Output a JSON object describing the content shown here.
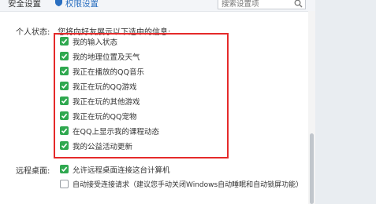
{
  "top_nav": {
    "safety_label": "安全设置",
    "permission_label": "权限设置",
    "search_placeholder": "搜索设置项"
  },
  "personal_status": {
    "label": "个人状态:",
    "hint": "您将向好友展示以下选中的信息:",
    "items": [
      {
        "label": "我的输入状态",
        "checked": true
      },
      {
        "label": "我的地理位置及天气",
        "checked": true
      },
      {
        "label": "我正在播放的QQ音乐",
        "checked": true
      },
      {
        "label": "我正在玩的QQ游戏",
        "checked": true
      },
      {
        "label": "我正在玩的其他游戏",
        "checked": true
      },
      {
        "label": "我正在玩的QQ宠物",
        "checked": true
      },
      {
        "label": "在QQ上显示我的课程动态",
        "checked": true
      },
      {
        "label": "我的公益活动更新",
        "checked": true
      }
    ]
  },
  "remote_desktop": {
    "label": "远程桌面:",
    "items": [
      {
        "label": "允许远程桌面连接这台计算机",
        "checked": true
      },
      {
        "label": "自动接受连接请求（建议您手动关闭Windows自动睡眠和自动锁屏功能）",
        "checked": false
      }
    ]
  },
  "colors": {
    "accent_green": "#2fa84f",
    "highlight_red": "#e52a2a",
    "link_blue": "#2a6fc0"
  },
  "icons": {
    "permission": "shield-icon",
    "search": "search-icon",
    "checkbox": "check-icon"
  }
}
